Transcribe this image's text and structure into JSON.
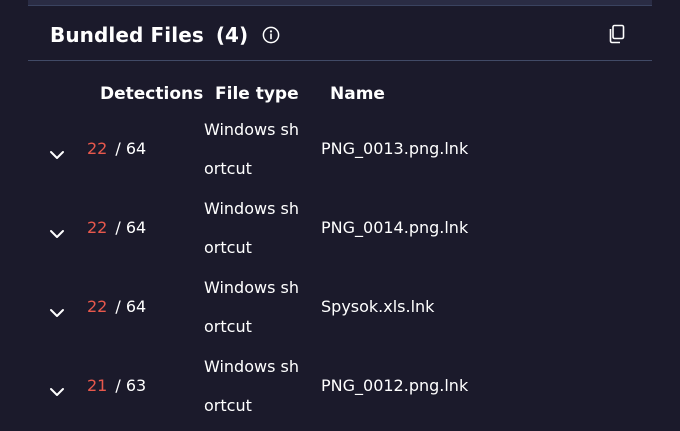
{
  "section": {
    "title": "Bundled Files",
    "count": "(4)"
  },
  "icons": {
    "info": "info-icon",
    "copy": "copy-icon",
    "expand": "chevron-down-icon"
  },
  "columns": {
    "detections": "Detections",
    "file_type": "File type",
    "name": "Name"
  },
  "colors": {
    "background": "#1b1a2b",
    "detections_positive": "#e8584c",
    "divider": "#414a66"
  },
  "files": [
    {
      "positives": "22",
      "total": "/ 64",
      "type_line1": "Windows sh",
      "type_line2": "ortcut",
      "name": "PNG_0013.png.lnk"
    },
    {
      "positives": "22",
      "total": "/ 64",
      "type_line1": "Windows sh",
      "type_line2": "ortcut",
      "name": "PNG_0014.png.lnk"
    },
    {
      "positives": "22",
      "total": "/ 64",
      "type_line1": "Windows sh",
      "type_line2": "ortcut",
      "name": "Spysok.xls.lnk"
    },
    {
      "positives": "21",
      "total": "/ 63",
      "type_line1": "Windows sh",
      "type_line2": "ortcut",
      "name": "PNG_0012.png.lnk"
    }
  ]
}
